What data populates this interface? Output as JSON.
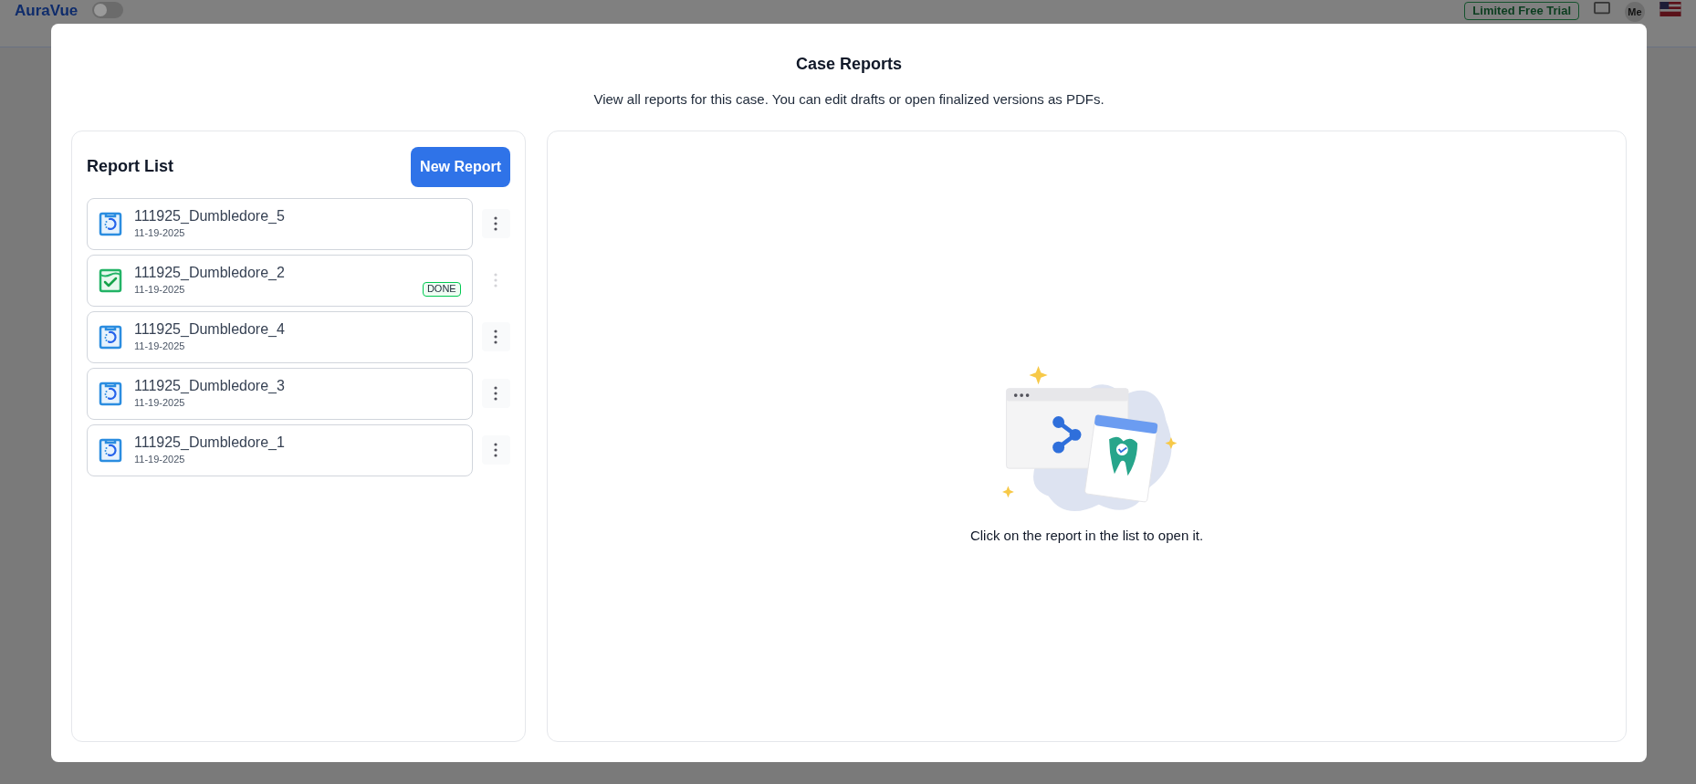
{
  "header": {
    "logo": "AuraVue",
    "theme_toggle": {
      "on": false
    },
    "trial_button": "Limited Free Trial",
    "avatar": "Me"
  },
  "dialog": {
    "title": "Case Reports",
    "subtitle": "View all reports for this case. You can edit drafts or open finalized versions as PDFs.",
    "report_list": {
      "title": "Report List",
      "new_button": "New Report",
      "reports": [
        {
          "name": "111925_Dumbledore_5",
          "date": "11-19-2025",
          "kind": "draft",
          "menu_disabled": false
        },
        {
          "name": "111925_Dumbledore_2",
          "date": "11-19-2025",
          "kind": "done",
          "badge": "DONE",
          "menu_disabled": true
        },
        {
          "name": "111925_Dumbledore_4",
          "date": "11-19-2025",
          "kind": "draft",
          "menu_disabled": false
        },
        {
          "name": "111925_Dumbledore_3",
          "date": "11-19-2025",
          "kind": "draft",
          "menu_disabled": false
        },
        {
          "name": "111925_Dumbledore_1",
          "date": "11-19-2025",
          "kind": "draft",
          "menu_disabled": false
        }
      ]
    },
    "empty_state": {
      "message": "Click on the report in the list to open it."
    }
  }
}
